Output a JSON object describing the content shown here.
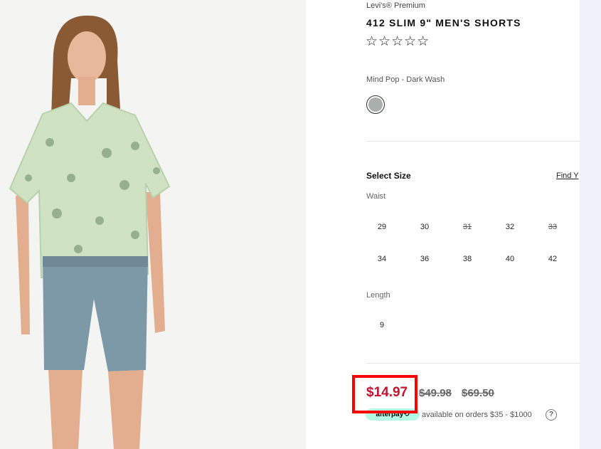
{
  "product": {
    "brand": "Levi's® Premium",
    "title": "412 SLIM 9\" MEN'S SHORTS",
    "rating_stars": "☆☆☆☆☆",
    "color_name": "Mind Pop - Dark Wash",
    "swatch_color": "#a9b0ac"
  },
  "size_selector": {
    "heading": "Select Size",
    "find_link": "Find Y",
    "waist_label": "Waist",
    "waist_sizes": [
      {
        "label": "29",
        "available": true
      },
      {
        "label": "30",
        "available": true
      },
      {
        "label": "31",
        "available": false
      },
      {
        "label": "32",
        "available": true
      },
      {
        "label": "33",
        "available": false
      },
      {
        "label": "34",
        "available": true
      },
      {
        "label": "36",
        "available": true
      },
      {
        "label": "38",
        "available": true
      },
      {
        "label": "40",
        "available": true
      },
      {
        "label": "42",
        "available": true
      }
    ],
    "length_label": "Length",
    "length_sizes": [
      {
        "label": "9",
        "available": true
      }
    ]
  },
  "pricing": {
    "sale_price": "$14.97",
    "old_price_1": "$49.98",
    "old_price_2": "$69.50",
    "sale_color": "#c41230",
    "highlight_color": "#ff0000",
    "afterpay_logo": "afterpay⟲",
    "afterpay_text": "available on orders $35 - $1000",
    "help_icon": "?"
  }
}
